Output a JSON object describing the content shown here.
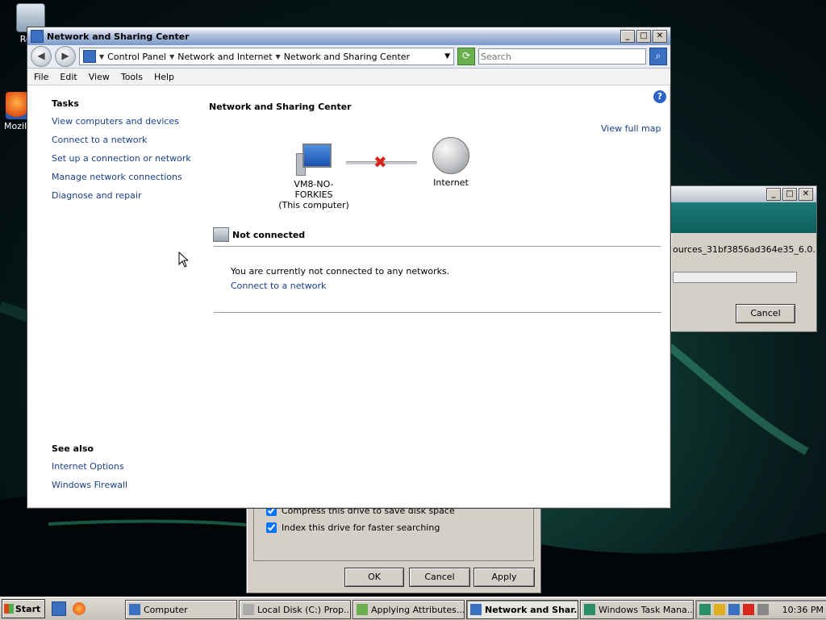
{
  "desktop": {
    "icons": [
      {
        "label": "Recy"
      },
      {
        "label": "Mozilla"
      }
    ]
  },
  "bg_window_progress": {
    "text": "ources_31bf3856ad364e35_6.0.",
    "cancel_label": "Cancel"
  },
  "bg_window_properties": {
    "check1_label": "Compress this drive to save disk space",
    "check2_label": "Index this drive for faster searching",
    "ok_label": "OK",
    "cancel_label": "Cancel",
    "apply_label": "Apply"
  },
  "main": {
    "title": "Network and Sharing Center",
    "breadcrumbs": [
      "Control Panel",
      "Network and Internet",
      "Network and Sharing Center"
    ],
    "search_placeholder": "Search",
    "menu": [
      "File",
      "Edit",
      "View",
      "Tools",
      "Help"
    ],
    "tasks_heading": "Tasks",
    "tasks": [
      "View computers and devices",
      "Connect to a network",
      "Set up a connection or network",
      "Manage network connections",
      "Diagnose and repair"
    ],
    "see_also_heading": "See also",
    "see_also": [
      "Internet Options",
      "Windows Firewall"
    ],
    "map_title": "Network and Sharing Center",
    "view_full_map": "View full map",
    "computer_name": "VM8-NO-FORKIES",
    "computer_sub": "(This computer)",
    "internet_label": "Internet",
    "status_heading": "Not connected",
    "status_message": "You are currently not connected to any networks.",
    "connect_link": "Connect to a network"
  },
  "taskbar": {
    "start_label": "Start",
    "tasks": [
      {
        "label": "Computer"
      },
      {
        "label": "Local Disk (C:) Prop..."
      },
      {
        "label": "Applying Attributes..."
      },
      {
        "label": "Network and Shar..."
      },
      {
        "label": "Windows Task Mana..."
      }
    ],
    "clock": "10:36 PM"
  },
  "colors": {
    "link": "#1a3f8f",
    "error_x": "#d9261c"
  }
}
